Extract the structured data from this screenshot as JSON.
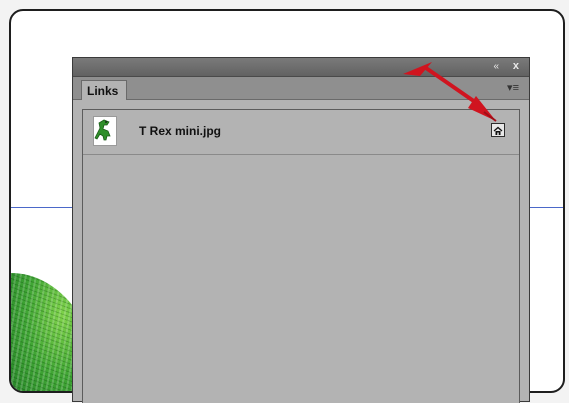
{
  "panel": {
    "tab_label": "Links",
    "collapse_glyph": "«",
    "close_glyph": "x",
    "menu_glyph": "▾≡"
  },
  "links": [
    {
      "name": "T Rex mini.jpg",
      "thumbnail_icon": "t-rex-thumbnail-icon",
      "status_icon": "linked-home-icon"
    }
  ],
  "colors": {
    "guide": "#4b68c9",
    "annotation_arrow": "#d0141f",
    "panel_bg": "#b3b3b3"
  }
}
